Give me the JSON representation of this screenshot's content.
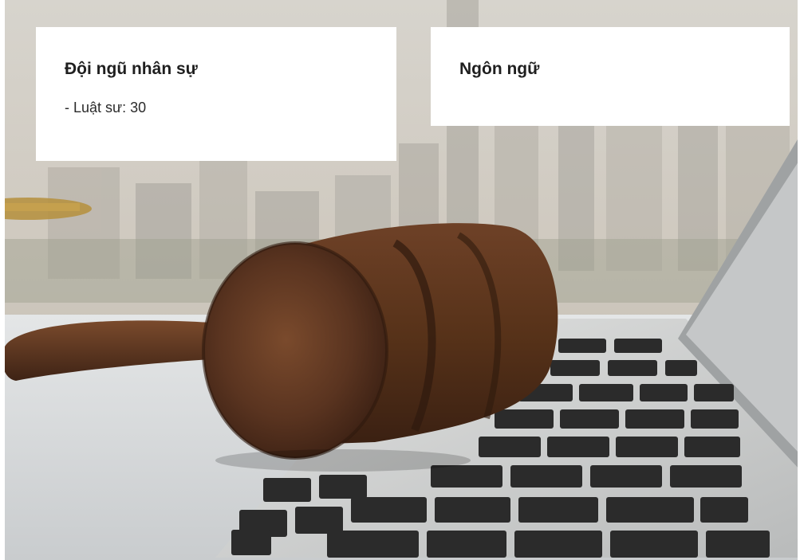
{
  "background": {
    "description_icon": "gavel-on-laptop-photo"
  },
  "cards": {
    "staff": {
      "title": "Đội ngũ nhân sự",
      "lines": [
        "- Luật sư: 30"
      ]
    },
    "language": {
      "title": "Ngôn ngữ"
    }
  },
  "colors": {
    "card_bg": "#ffffff",
    "title": "#1f1f1f",
    "text": "#2a2a2a",
    "gavel": "#5a3420",
    "laptop": "#d9d9d6",
    "keys": "#2b2b2b"
  }
}
